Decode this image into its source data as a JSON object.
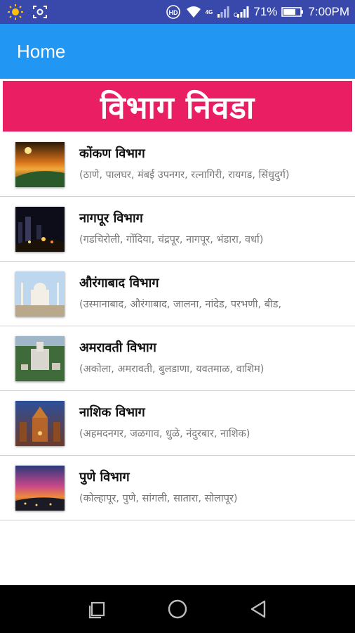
{
  "status_bar": {
    "battery": "71%",
    "time": "7:00PM",
    "hd_label": "HD",
    "network_label": "4G",
    "colors": {
      "background": "#3949ab"
    }
  },
  "app_bar": {
    "title": "Home",
    "color": "#2196f3"
  },
  "banner": {
    "text": "विभाग निवडा",
    "color": "#e91e63"
  },
  "divisions": [
    {
      "title": "कोंकण विभाग",
      "districts": "(ठाणे, पालघर, मंबई उपनगर, रत्नागिरी, रायगड, सिंधुदुर्ग)",
      "thumb": "sunset-coast"
    },
    {
      "title": "नागपूर विभाग",
      "districts": "(गडचिरोली, गोंदिया, चंद्रपूर, नागपूर, भंडारा, वर्धा)",
      "thumb": "city-night"
    },
    {
      "title": "औरंगाबाद विभाग",
      "districts": "(उस्मानाबाद, औरंगाबाद, जालना, नांदेड, परभणी, बीड,",
      "thumb": "monument"
    },
    {
      "title": "अमरावती विभाग",
      "districts": "(अकोला, अमरावती, बुलडाणा, यवतमाळ, वाशिम)",
      "thumb": "temple-aerial"
    },
    {
      "title": "नाशिक विभाग",
      "districts": "(अहमदनगर, जळगाव, धुळे, नंदुरबार, नाशिक)",
      "thumb": "temple-evening"
    },
    {
      "title": "पुणे विभाग",
      "districts": "(कोल्हापूर, पुणे, सांगली, सातारा, सोलापूर)",
      "thumb": "dusk-sky"
    }
  ],
  "nav_bar": {
    "buttons": [
      "recent-apps",
      "home",
      "back"
    ]
  }
}
